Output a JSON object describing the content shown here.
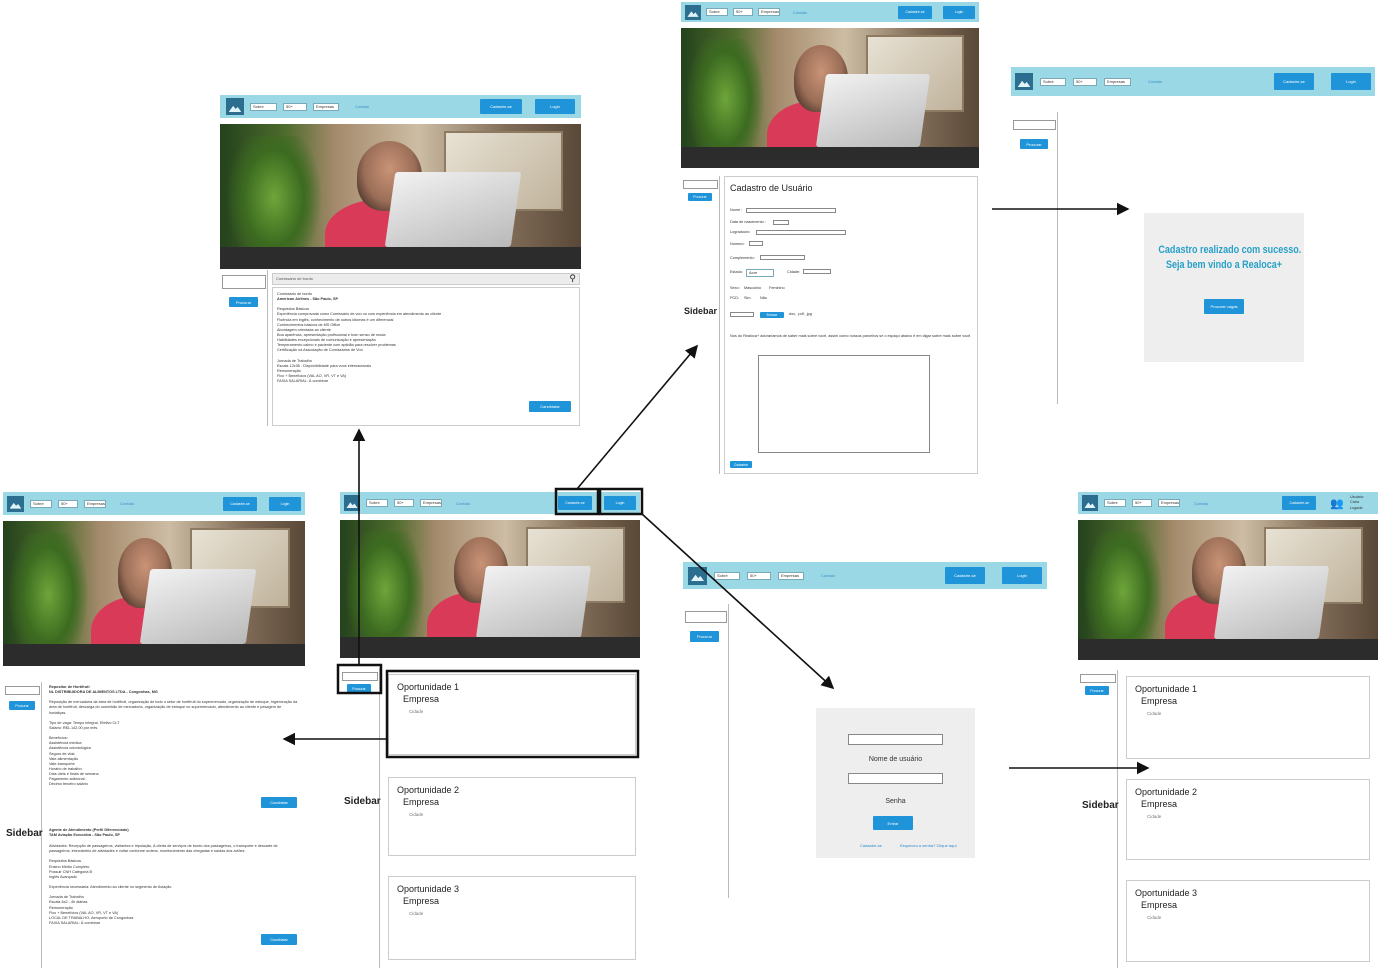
{
  "nav": {
    "sobre": "Sobre",
    "age": "50+",
    "empresas": "Empresas",
    "link": "Contato",
    "cadastro": "Cadastre-se",
    "login": "Login"
  },
  "sidebar": {
    "search_button": "Procurar",
    "label": "Sidebar"
  },
  "opportunities": [
    {
      "title": "Oportunidade 1",
      "company": "Empresa",
      "city": "Cidade"
    },
    {
      "title": "Oportunidade 2",
      "company": "Empresa",
      "city": "Cidade"
    },
    {
      "title": "Oportunidade 3",
      "company": "Empresa",
      "city": "Cidade"
    }
  ],
  "job_detail": {
    "search_placeholder": "Comissário de bordo",
    "title": "Comissário de bordo",
    "company": "American Airlines - São Paulo, SP",
    "body": "Requisitos Básicos\nExperiência comprovada como Comissário de voo ou com experiência em atendimento ao cliente\nFluência em inglês, conhecimento de outros idiomas é um diferencial\nConhecimentos básicos de MS Office\nAbordagem orientada ao cliente\nBoa aparência, apresentação profissional e bom senso de moda\nHabilidades excepcionais de comunicação e apresentação\nTemperamento calmo e paciente com aptidão para resolver problemas\nCertificação na Associação de Comissários de Voo\n\nJornada de Trabalho\nEscala 12x36 - Disponibilidade para voos internacionais\nRemuneração\nFixo + Benefícios (VAL AO, VR, VT e VA)\nFAIXA SALARIAL: À combinar",
    "apply": "Candidatar"
  },
  "job_list": {
    "job1_title": "Repositor de Hortifruti",
    "job1_company": "NL DISTRIBUIDORA DE ALIMENTOS LTDA - Congonhas, MG",
    "job1_body": "Reposição de mercadoria da área de hortifruti, organização de todo o setor de hortifruti do supermercado, organização de estoque, higienização da área de hortifruti, descarga do caminhão de mercadoria, organização de estoque no supermercado, atendimento ao cliente e pesagem de hortaliças.\n\nTipo de vaga: Tempo integral, Efetivo CLT\nSalário: R$1.142,00 por mês\n\nBenefícios:\nAssistência médica\nAssistência odontológica\nSeguro de vida\nVale-alimentação\nVale-transporte\nHorário de trabalho:\nDias úteis e finais de semana\nPagamento adicional:\nDécimo terceiro salário",
    "job2_title": "Agente de Atendimento (Perfil Diferenciado)",
    "job2_company": "TAM Aviação Executiva - São Paulo, SP",
    "job2_body": "Atividades: Recepção de passageiros, visitantes e tripulação, A oferta de serviços de bordo dos passageiros, o transporte e descarte de passageiros, intercâmbio de atividades e voltar conforme ordens, monitoramento das chegadas e saídas dos aviões.\n\nRequisitos Básicos\nEnsino Médio Completo\nPossuir CNH Categoria B\nInglês Avançado\n\nExperiência necessária: Atendimento ao cliente no segmento de Aviação\n\nJornada de Trabalho\nEscala 6x2 - 4h diárias\nRemuneração\nFixo + Benefícios (VAL AO, VR, VT e VA)\nLOCAL DE TRABALHO: Aeroporto de Congonhas\nFAIXA SALARIAL: À combinar",
    "apply": "Candidatar"
  },
  "signup": {
    "title": "Cadastro de Usuário",
    "nome": "Nome :",
    "nascimento": "Data de nascimento :",
    "logradouro": "Logradouro:",
    "numero": "Número:",
    "complemento": "Complemento:",
    "estado": "Estado:",
    "estado_value": "Acre",
    "cidade": "Cidade:",
    "sexo": "Sexo:",
    "masculino": "Masculino",
    "feminino": "Feminino",
    "pcd": "PCD:",
    "sim": "Sim",
    "nao": "Não",
    "upload_btn": "Browse",
    "upload_hint": ".doc, .pdf, .jpg",
    "question": "Nós do Realoca+ adoraríamos de saber mais sobre você, assim como nossos parceiros se o espaço abaixo é em digar sobre mais sobre você.",
    "submit": "Cadastrar"
  },
  "success": {
    "line1": "Cadastro realizado com sucesso.",
    "line2": "Seja bem vindo a Realoca+",
    "button": "Procurar vagas"
  },
  "login": {
    "user_label": "Nome de usuário",
    "pass_label": "Senha",
    "enter": "Entrar",
    "signup_link": "Cadastre-se",
    "forgot_link": "Esqueceu a senha? Clique aqui"
  },
  "logged": {
    "user_text": "Usuário: Carla\nLogado"
  },
  "colors": {
    "nav": "#9ad8e6",
    "button": "#1f94d8",
    "success_text": "#28a0c8"
  }
}
